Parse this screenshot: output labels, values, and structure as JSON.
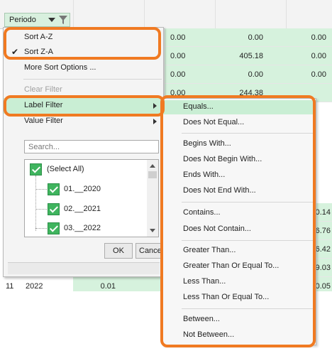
{
  "header": {
    "field_button_label": "Periodo",
    "dropdown_icon": "dropdown-arrow-icon",
    "filter_icon": "funnel-icon"
  },
  "grid": {
    "col_a": [
      {
        "value": "0.00",
        "hl": true
      },
      {
        "value": "0.00",
        "hl": true
      },
      {
        "value": "0.00",
        "hl": true
      },
      {
        "value": "0.00",
        "hl": true
      }
    ],
    "col_b": [
      {
        "value": "0.00",
        "hl": true
      },
      {
        "value": "405.18",
        "hl": true
      },
      {
        "value": "0.00",
        "hl": true
      },
      {
        "value": "244.38",
        "hl": true
      }
    ],
    "col_c": [
      {
        "value": "0.00",
        "hl": true
      },
      {
        "value": "0.00",
        "hl": true
      },
      {
        "value": "0.00",
        "hl": true
      },
      {
        "value": "",
        "hl": true
      }
    ],
    "right_partial": [
      "0.14",
      "6.76",
      "6.42",
      "9.03",
      "0.05"
    ],
    "bottom_row": {
      "left_a": "11",
      "left_b": "2022",
      "mid": "0.01"
    }
  },
  "context_menu": {
    "sort_az": "Sort A-Z",
    "sort_za": "Sort Z-A",
    "more_sort": "More Sort Options ...",
    "clear_filter": "Clear Filter",
    "label_filter": "Label Filter",
    "value_filter": "Value Filter",
    "search_placeholder": "Search...",
    "tree": {
      "select_all": "(Select All)",
      "items": [
        "01.__2020",
        "02.__2021",
        "03.__2022"
      ]
    },
    "ok": "OK",
    "cancel": "Cance"
  },
  "label_filter_submenu": [
    {
      "label": "Equals..."
    },
    {
      "label": "Does Not Equal..."
    },
    {
      "label": "Begins With..."
    },
    {
      "label": "Does Not Begin With..."
    },
    {
      "label": "Ends With..."
    },
    {
      "label": "Does Not End With..."
    },
    {
      "label": "Contains..."
    },
    {
      "label": "Does Not Contain..."
    },
    {
      "label": "Greater Than..."
    },
    {
      "label": "Greater Than Or Equal To..."
    },
    {
      "label": "Less Than..."
    },
    {
      "label": "Less Than Or Equal To..."
    },
    {
      "label": "Between..."
    },
    {
      "label": "Not Between..."
    }
  ],
  "colors": {
    "highlight": "#c9eed4",
    "cell_green": "#d6f2dd",
    "outline": "#f07a22",
    "checkbox": "#3fb45e"
  }
}
